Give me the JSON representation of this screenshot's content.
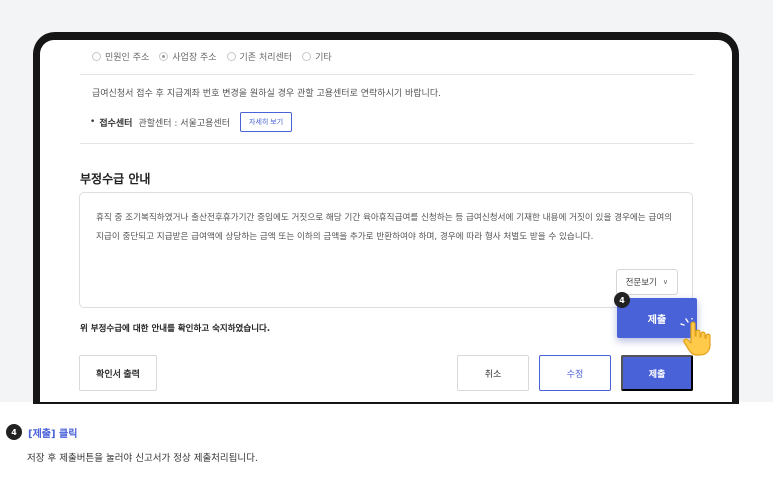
{
  "radio_options": [
    {
      "label": "민원인 주소",
      "selected": false
    },
    {
      "label": "사업장 주소",
      "selected": true
    },
    {
      "label": "기존 처리센터",
      "selected": false
    },
    {
      "label": "기타",
      "selected": false
    }
  ],
  "notice": "급여신청서 접수 후 지급계좌 번호 변경을 원하실 경우 관할 고용센터로 연락하시기 바랍니다.",
  "reception": {
    "bullet": "•",
    "label": "접수센터",
    "value": "관할센터 : 서울고용센터",
    "detail_button": "자세히 보기"
  },
  "section": {
    "title": "부정수급 안내",
    "text": "휴직 중 조기복직하였거나 출산전후휴가기간 중임에도 거짓으로 해당 기간 육아휴직급여를 신청하는 등 급여신청서에 기재한 내용에 거짓이 있을 경우에는 급여의 지급이 중단되고 지급받은 급여액에 상당하는 금액 또는 이하의 금액을 추가로 반환하여야 하며, 경우에 따라 형사 처벌도 받을 수 있습니다.",
    "more_button": "전문보기",
    "confirm_text": "위 부정수급에 대한 안내를 확인하고 숙지하였습니다."
  },
  "buttons": {
    "print": "확인서 출력",
    "cancel": "취소",
    "edit": "수정",
    "submit": "제출"
  },
  "highlight": {
    "step": "4",
    "label": "제출"
  },
  "caption": {
    "step": "4",
    "title": "[제출] 클릭",
    "description": "저장 후 제출버튼을 눌러야 신고서가 정상 제출처리됩니다."
  },
  "colors": {
    "accent": "#4a62d8",
    "device_frame": "#151515",
    "background": "#f3f4f6"
  }
}
